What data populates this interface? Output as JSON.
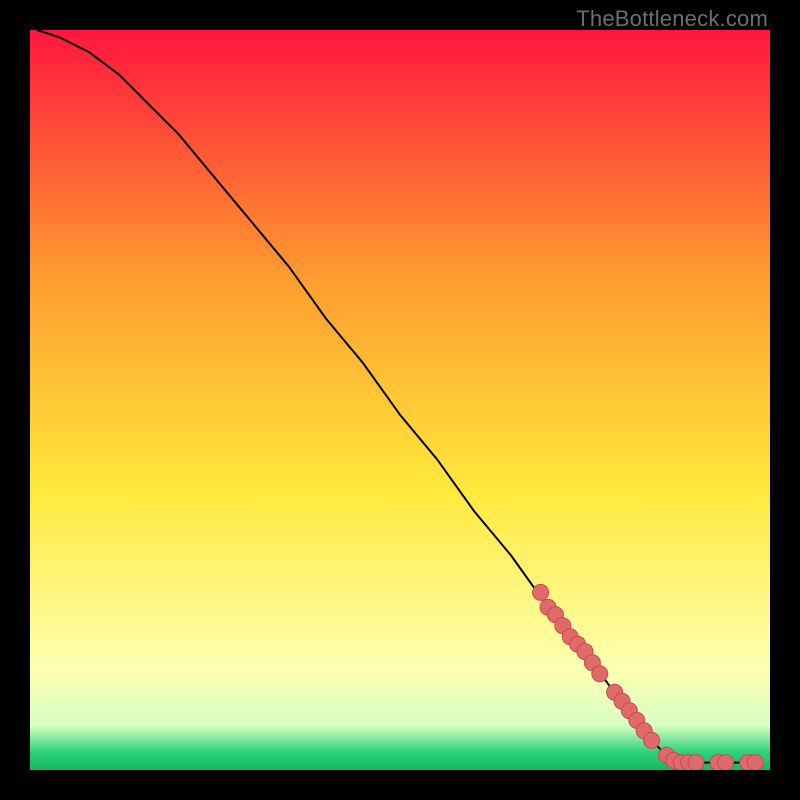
{
  "attribution": "TheBottleneck.com",
  "colors": {
    "bg": "#000000",
    "grad_top": "#ff163e",
    "grad_mid1": "#ff9a2f",
    "grad_mid2": "#ffe93b",
    "grad_pale": "#ffffb0",
    "grad_green": "#2fd479",
    "curve": "#000000",
    "marker_fill": "#e06a6a",
    "marker_stroke": "#c34d4d"
  },
  "chart_data": {
    "type": "line",
    "title": "",
    "xlabel": "",
    "ylabel": "",
    "xlim": [
      0,
      100
    ],
    "ylim": [
      0,
      100
    ],
    "curve": [
      {
        "x": 1,
        "y": 100
      },
      {
        "x": 4,
        "y": 99
      },
      {
        "x": 8,
        "y": 97
      },
      {
        "x": 12,
        "y": 94
      },
      {
        "x": 16,
        "y": 90
      },
      {
        "x": 20,
        "y": 86
      },
      {
        "x": 25,
        "y": 80
      },
      {
        "x": 30,
        "y": 74
      },
      {
        "x": 35,
        "y": 68
      },
      {
        "x": 40,
        "y": 61
      },
      {
        "x": 45,
        "y": 55
      },
      {
        "x": 50,
        "y": 48
      },
      {
        "x": 55,
        "y": 42
      },
      {
        "x": 60,
        "y": 35
      },
      {
        "x": 65,
        "y": 29
      },
      {
        "x": 70,
        "y": 22
      },
      {
        "x": 75,
        "y": 16
      },
      {
        "x": 80,
        "y": 9
      },
      {
        "x": 84,
        "y": 4
      },
      {
        "x": 86,
        "y": 2
      },
      {
        "x": 88,
        "y": 1
      },
      {
        "x": 90,
        "y": 1
      },
      {
        "x": 93,
        "y": 1
      },
      {
        "x": 96,
        "y": 1
      },
      {
        "x": 99,
        "y": 1
      }
    ],
    "markers": [
      {
        "x": 69,
        "y": 24
      },
      {
        "x": 70,
        "y": 22
      },
      {
        "x": 71,
        "y": 21
      },
      {
        "x": 72,
        "y": 19.5
      },
      {
        "x": 73,
        "y": 18
      },
      {
        "x": 74,
        "y": 17
      },
      {
        "x": 75,
        "y": 16
      },
      {
        "x": 76,
        "y": 14.5
      },
      {
        "x": 77,
        "y": 13
      },
      {
        "x": 79,
        "y": 10.5
      },
      {
        "x": 80,
        "y": 9.3
      },
      {
        "x": 81,
        "y": 8
      },
      {
        "x": 82,
        "y": 6.7
      },
      {
        "x": 83,
        "y": 5.3
      },
      {
        "x": 84,
        "y": 4
      },
      {
        "x": 86,
        "y": 2
      },
      {
        "x": 87,
        "y": 1.3
      },
      {
        "x": 88,
        "y": 1
      },
      {
        "x": 89,
        "y": 1
      },
      {
        "x": 90,
        "y": 1
      },
      {
        "x": 93,
        "y": 1
      },
      {
        "x": 94,
        "y": 1
      },
      {
        "x": 97,
        "y": 1
      },
      {
        "x": 98,
        "y": 1
      }
    ]
  }
}
